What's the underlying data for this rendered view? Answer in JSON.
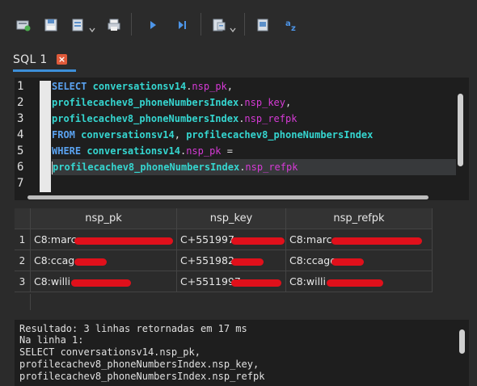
{
  "toolbar": {
    "items": [
      "new-connection-icon",
      "save-icon",
      "export-icon",
      "print-icon",
      "run-icon",
      "run-step-icon",
      "format-icon",
      "explain-icon",
      "translate-icon"
    ]
  },
  "tab": {
    "label": "SQL 1",
    "close_glyph": "×"
  },
  "editor": {
    "line_numbers": [
      "1",
      "2",
      "3",
      "4",
      "5",
      "6",
      "7"
    ],
    "lines": [
      [
        {
          "t": "kw",
          "v": "SELECT"
        },
        {
          "t": "pl",
          "v": " "
        },
        {
          "t": "id",
          "v": "conversationsv14"
        },
        {
          "t": "pl",
          "v": "."
        },
        {
          "t": "at",
          "v": "nsp_pk"
        },
        {
          "t": "pl",
          "v": ","
        }
      ],
      [
        {
          "t": "id",
          "v": "profilecachev8_phoneNumbersIndex"
        },
        {
          "t": "pl",
          "v": "."
        },
        {
          "t": "at",
          "v": "nsp_key"
        },
        {
          "t": "pl",
          "v": ","
        }
      ],
      [
        {
          "t": "id",
          "v": "profilecachev8_phoneNumbersIndex"
        },
        {
          "t": "pl",
          "v": "."
        },
        {
          "t": "at",
          "v": "nsp_refpk"
        }
      ],
      [
        {
          "t": "kw",
          "v": "FROM"
        },
        {
          "t": "pl",
          "v": " "
        },
        {
          "t": "id",
          "v": "conversationsv14"
        },
        {
          "t": "pl",
          "v": ", "
        },
        {
          "t": "id",
          "v": "profilecachev8_phoneNumbersIndex"
        }
      ],
      [
        {
          "t": "kw",
          "v": "WHERE"
        },
        {
          "t": "pl",
          "v": " "
        },
        {
          "t": "id",
          "v": "conversationsv14"
        },
        {
          "t": "pl",
          "v": "."
        },
        {
          "t": "at",
          "v": "nsp_pk"
        },
        {
          "t": "pl",
          "v": " ="
        }
      ],
      [
        {
          "t": "id",
          "v": "profilecachev8_phoneNumbersIndex"
        },
        {
          "t": "pl",
          "v": "."
        },
        {
          "t": "at",
          "v": "nsp_refpk"
        }
      ],
      []
    ]
  },
  "grid": {
    "columns": [
      "nsp_pk",
      "nsp_key",
      "nsp_refpk"
    ],
    "rows": [
      {
        "num": "1",
        "cells": [
          "C8:marc",
          "C+551997",
          "C8:marc"
        ]
      },
      {
        "num": "2",
        "cells": [
          "C8:ccag",
          "C+551982",
          "C8:ccage"
        ]
      },
      {
        "num": "3",
        "cells": [
          "C8:willi",
          "C+5511997",
          "C8:willi"
        ]
      }
    ]
  },
  "output": {
    "lines": [
      "Resultado: 3 linhas retornadas em 17 ms",
      "Na linha 1:",
      "SELECT conversationsv14.nsp_pk,",
      "profilecachev8_phoneNumbersIndex.nsp_key,",
      "profilecachev8_phoneNumbersIndex.nsp_refpk"
    ]
  },
  "colors": {
    "keyword": "#5aa2f0",
    "identifier": "#35d6d0",
    "attribute": "#d63ad6",
    "tab_accent": "#3d8fd9",
    "redaction": "#e0101b"
  }
}
